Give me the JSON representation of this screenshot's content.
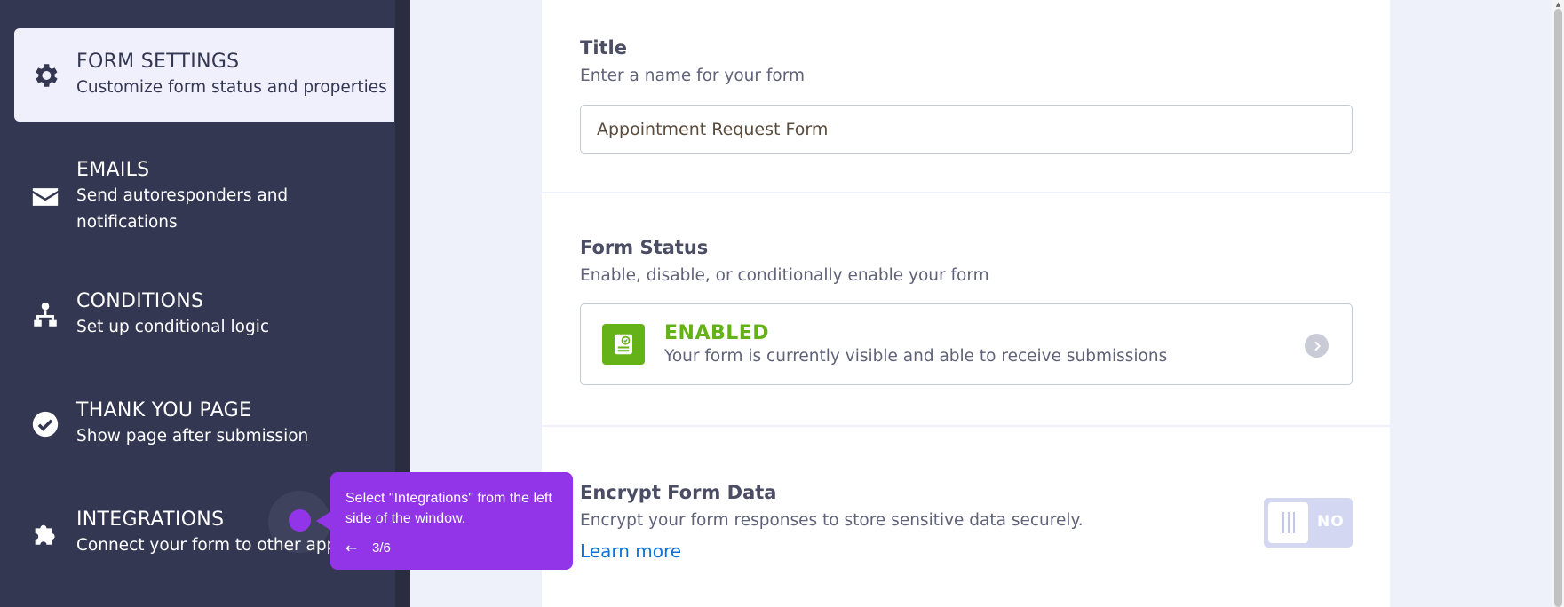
{
  "sidebar": {
    "items": [
      {
        "title": "FORM SETTINGS",
        "subtitle": "Customize form status and properties",
        "icon": "gear-icon",
        "active": true
      },
      {
        "title": "EMAILS",
        "subtitle_line1": "Send autoresponders and",
        "subtitle_line2": "notifications",
        "icon": "envelope-icon"
      },
      {
        "title": "CONDITIONS",
        "subtitle": "Set up conditional logic",
        "icon": "sitemap-icon"
      },
      {
        "title": "THANK YOU PAGE",
        "subtitle": "Show page after submission",
        "icon": "check-circle-icon"
      },
      {
        "title": "INTEGRATIONS",
        "subtitle": "Connect your form to other app",
        "icon": "puzzle-icon"
      }
    ]
  },
  "title_section": {
    "heading": "Title",
    "description": "Enter a name for your form",
    "value": "Appointment Request Form"
  },
  "status_section": {
    "heading": "Form Status",
    "description": "Enable, disable, or conditionally enable your form",
    "status_label": "ENABLED",
    "status_description": "Your form is currently visible and able to receive submissions",
    "status_color": "#64b218"
  },
  "encrypt_section": {
    "heading": "Encrypt Form Data",
    "description": "Encrypt your form responses to store sensitive data securely.",
    "link": "Learn more",
    "toggle_label": "NO"
  },
  "tooltip": {
    "text": "Select \"Integrations\" from the left side of the window.",
    "back_arrow": "←",
    "step": "3/6",
    "color": "#9235e8"
  },
  "colors": {
    "sidebar": "#343752",
    "link": "#0a73d8"
  }
}
